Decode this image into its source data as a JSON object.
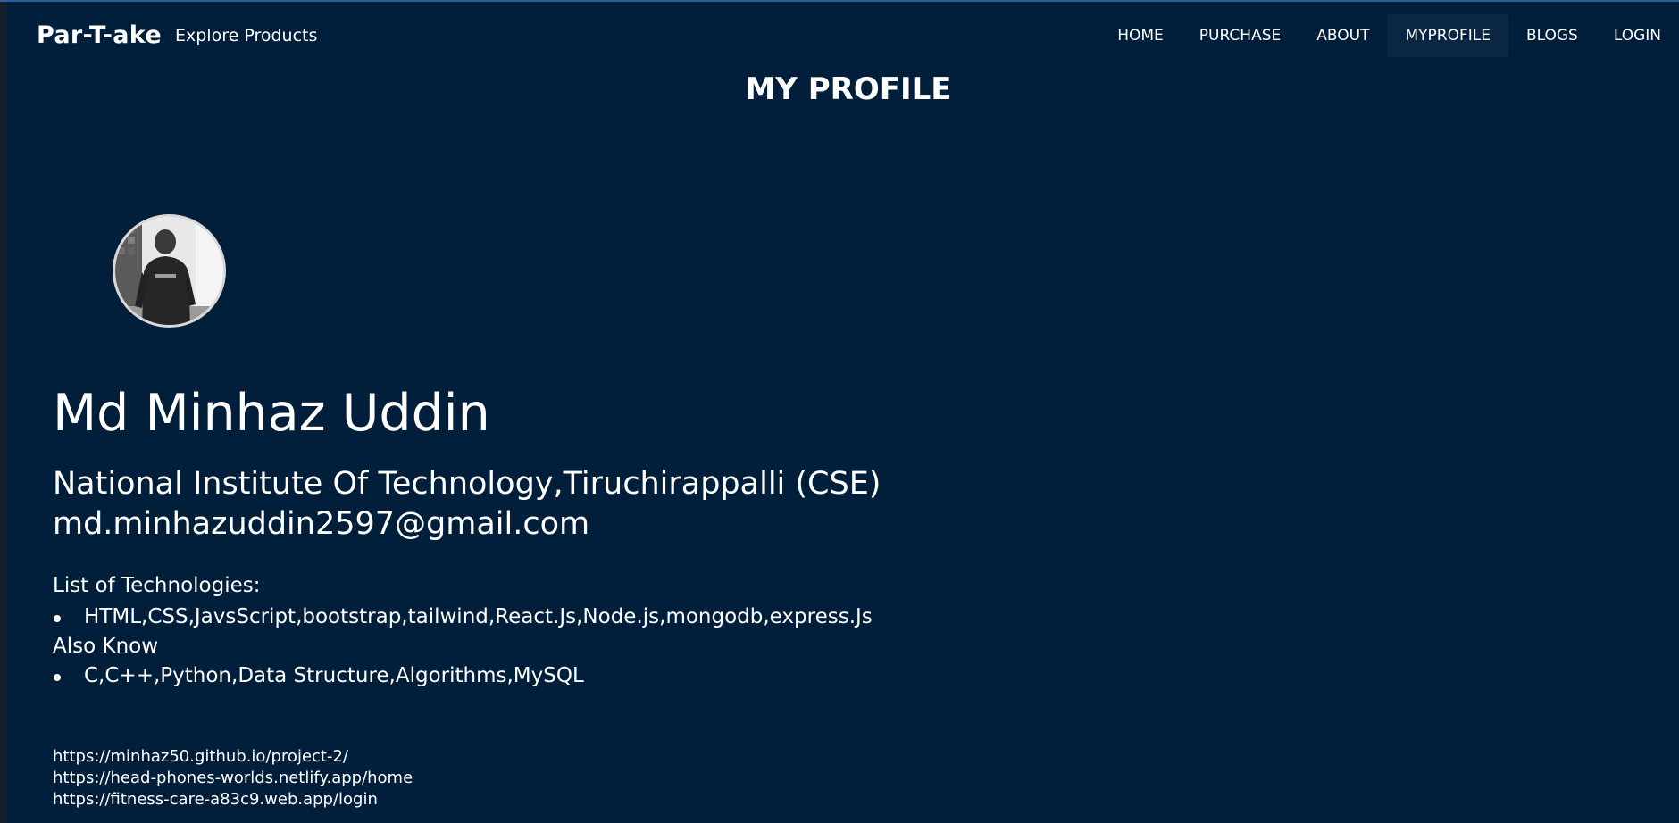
{
  "navbar": {
    "brand": "Par-T-ake",
    "explore": "Explore Products",
    "links": [
      "HOME",
      "PURCHASE",
      "ABOUT",
      "MYPROFILE",
      "BLOGS",
      "LOGIN"
    ],
    "active": "MYPROFILE"
  },
  "page": {
    "title": "MY PROFILE"
  },
  "profile": {
    "name": "Md Minhaz Uddin",
    "institute": "National Institute Of Technology,Tiruchirappalli (CSE)",
    "email": "md.minhazuddin2597@gmail.com",
    "tech_heading": "List of Technologies:",
    "technologies": [
      "HTML,CSS,JavsScript,bootstrap,tailwind,React.Js,Node.js,mongodb,express.Js"
    ],
    "also_heading": "Also Know",
    "also_know": [
      "C,C++,Python,Data Structure,Algorithms,MySQL"
    ],
    "projects": [
      "https://minhaz50.github.io/project-2/",
      "https://head-phones-worlds.netlify.app/home",
      "https://fitness-care-a83c9.web.app/login"
    ]
  },
  "colors": {
    "background": "#011f3a",
    "text": "#ffffff",
    "active_nav": "#0a2642"
  }
}
